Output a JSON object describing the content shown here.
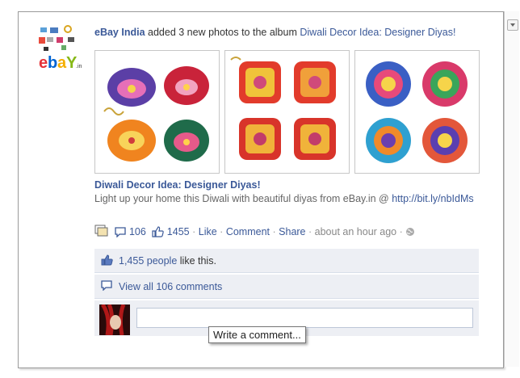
{
  "post": {
    "actor": "eBay India",
    "verb": "added 3 new photos to the album",
    "album": "Diwali Decor Idea: Designer Diyas!",
    "title": "Diwali Decor Idea: Designer Diyas!",
    "description": "Light up your home this Diwali with beautiful diyas from eBay.in @",
    "link": "http://bit.ly/nbIdMs",
    "comment_count": "106",
    "like_count": "1455",
    "like_label": "Like",
    "comment_label": "Comment",
    "share_label": "Share",
    "timestamp": "about an hour ago",
    "separator": "·"
  },
  "likes_row": {
    "count_text": "1,455 people",
    "suffix": "like this."
  },
  "comments_row": {
    "text": "View all 106 comments"
  },
  "comment_box": {
    "tooltip": "Write a comment..."
  },
  "colors": {
    "link": "#3b5998",
    "ufi_bg": "#edeff4"
  }
}
